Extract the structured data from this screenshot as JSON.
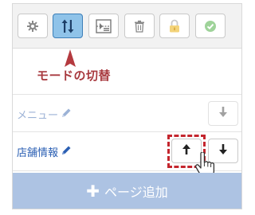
{
  "toolbar": {
    "buttons": [
      {
        "name": "settings",
        "icon": "gear-icon",
        "active": false
      },
      {
        "name": "mode-toggle",
        "icon": "sort-arrows-icon",
        "active": true
      },
      {
        "name": "add-section",
        "icon": "insert-block-icon",
        "active": false
      },
      {
        "name": "delete",
        "icon": "trash-icon",
        "active": false
      },
      {
        "name": "lock",
        "icon": "lock-icon",
        "active": false
      },
      {
        "name": "confirm",
        "icon": "check-circle-icon",
        "active": false
      }
    ]
  },
  "callout": {
    "label": "モードの切替",
    "color": "#a83a3f"
  },
  "rows": [
    {
      "label": "メニュー",
      "color": "#9cb2d6",
      "actions": [
        "down"
      ]
    },
    {
      "label": "店舗情報",
      "color": "#2b5fb3",
      "actions": [
        "up",
        "down"
      ]
    }
  ],
  "add_button": {
    "label": "ページ追加",
    "color": "#adc3e3"
  },
  "colors": {
    "active_button": "#8fc3e9",
    "highlight": "#c4262e"
  }
}
